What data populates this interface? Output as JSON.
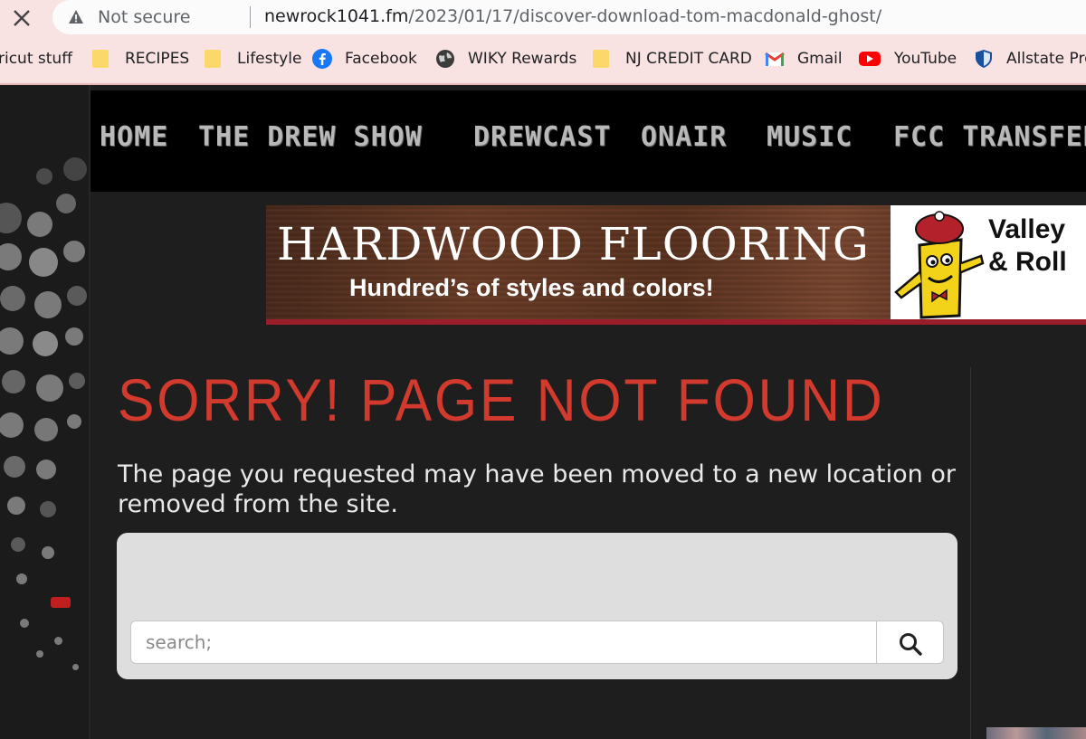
{
  "browser": {
    "security_label": "Not secure",
    "url_host": "newrock1041.fm",
    "url_path": "/2023/01/17/discover-download-tom-macdonald-ghost/",
    "bookmarks": [
      {
        "label": "ricut stuff",
        "icon": "none"
      },
      {
        "label": "RECIPES",
        "icon": "folder-icon"
      },
      {
        "label": "Lifestyle",
        "icon": "folder-icon"
      },
      {
        "label": "Facebook",
        "icon": "facebook-icon"
      },
      {
        "label": "WIKY Rewards",
        "icon": "globe-icon"
      },
      {
        "label": "NJ CREDIT CARD",
        "icon": "folder-icon"
      },
      {
        "label": "Gmail",
        "icon": "gmail-icon"
      },
      {
        "label": "YouTube",
        "icon": "youtube-icon"
      },
      {
        "label": "Allstate Pro",
        "icon": "shield-icon"
      }
    ]
  },
  "nav": {
    "items": [
      "HOME",
      "THE DREW SHOW",
      "DREWCAST",
      "ONAIR",
      "MUSIC",
      "FCC TRANSFER"
    ]
  },
  "ad": {
    "headline": "HARDWOOD FLOORING",
    "subline": "Hundred’s of styles and colors!",
    "brand_line1": "Valley",
    "brand_line2": "& Roll"
  },
  "error": {
    "title": "SORRY! PAGE NOT FOUND",
    "message": "The page you requested may have been moved to a new location or removed from the site."
  },
  "search": {
    "placeholder": "search;"
  },
  "colors": {
    "accent_red": "#d23a2e",
    "chrome_pink": "#f9e2e2",
    "page_bg": "#1e1e1e"
  }
}
